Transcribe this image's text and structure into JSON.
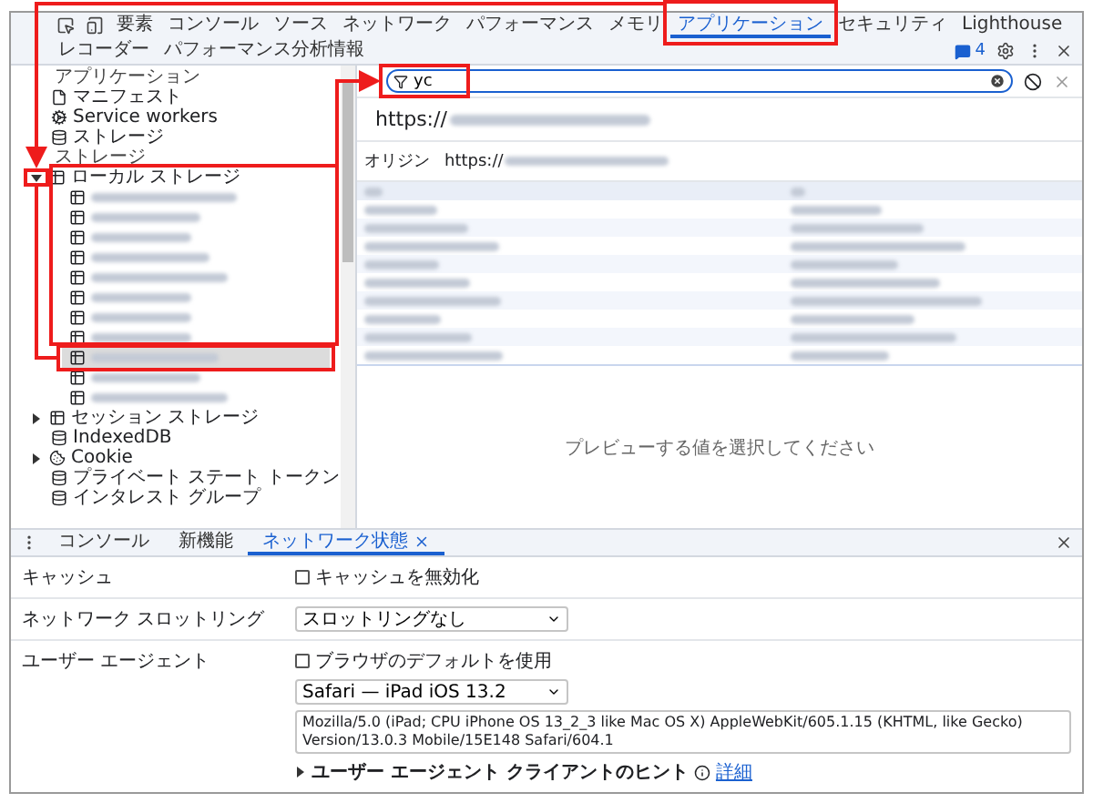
{
  "toolbar": {
    "tabs": [
      {
        "label": "要素",
        "selected": false,
        "annotated": false
      },
      {
        "label": "コンソール",
        "selected": false,
        "annotated": false
      },
      {
        "label": "ソース",
        "selected": false,
        "annotated": false
      },
      {
        "label": "ネットワーク",
        "selected": false,
        "annotated": false
      },
      {
        "label": "パフォーマンス",
        "selected": false,
        "annotated": false
      },
      {
        "label": "メモリ",
        "selected": false,
        "annotated": false
      },
      {
        "label": "アプリケーション",
        "selected": true,
        "annotated": true
      },
      {
        "label": "セキュリティ",
        "selected": false,
        "annotated": false
      },
      {
        "label": "Lighthouse",
        "selected": false,
        "annotated": false
      },
      {
        "label": "レコーダー",
        "selected": false,
        "annotated": false
      },
      {
        "label": "パフォーマンス分析情報",
        "selected": false,
        "annotated": false
      }
    ],
    "issues_count": "4"
  },
  "sidebar": {
    "sections": [
      {
        "title": "アプリケーション",
        "items": [
          {
            "label": "マニフェスト"
          },
          {
            "label": "Service workers"
          },
          {
            "label": "ストレージ"
          }
        ]
      },
      {
        "title": "ストレージ",
        "items": [
          {
            "label": "ローカル ストレージ",
            "expanded": true,
            "annotated": true,
            "children": [
              {
                "selected": false
              },
              {
                "selected": false
              },
              {
                "selected": false
              },
              {
                "selected": false
              },
              {
                "selected": false
              },
              {
                "selected": false
              },
              {
                "selected": false
              },
              {
                "selected": false
              },
              {
                "selected": true
              },
              {
                "selected": false
              },
              {
                "selected": false
              }
            ]
          },
          {
            "label": "セッション ストレージ",
            "expanded": false
          },
          {
            "label": "IndexedDB"
          },
          {
            "label": "Cookie",
            "expanded": false
          },
          {
            "label": "プライベート ステート トークン"
          },
          {
            "label": "インタレスト グループ"
          }
        ]
      }
    ]
  },
  "filter": {
    "value": "yc",
    "annotated": true
  },
  "detail": {
    "url_prefix": "https://",
    "origin_label": "オリジン",
    "origin_prefix": "https://",
    "rows": [
      {
        "selected": false
      },
      {
        "selected": false
      },
      {
        "selected": false
      },
      {
        "selected": false
      },
      {
        "selected": false
      },
      {
        "selected": false
      },
      {
        "selected": false
      },
      {
        "selected": false
      },
      {
        "selected": false
      }
    ],
    "preview_message": "プレビューする値を選択してください"
  },
  "drawer": {
    "tabs": [
      {
        "label": "コンソール",
        "selected": false,
        "closable": false
      },
      {
        "label": "新機能",
        "selected": false,
        "closable": false
      },
      {
        "label": "ネットワーク状態",
        "selected": true,
        "closable": true
      }
    ],
    "settings": [
      {
        "label": "キャッシュ",
        "controls": [
          {
            "kind": "checkbox",
            "label": "キャッシュを無効化",
            "checked": false
          }
        ]
      },
      {
        "label": "ネットワーク スロットリング",
        "controls": [
          {
            "kind": "select",
            "value": "スロットリングなし"
          }
        ]
      },
      {
        "label": "ユーザー エージェント",
        "controls": [
          {
            "kind": "checkbox",
            "label": "ブラウザのデフォルトを使用",
            "checked": false
          },
          {
            "kind": "select",
            "value": "Safari — iPad iOS 13.2"
          },
          {
            "kind": "text",
            "value": "Mozilla/5.0 (iPad; CPU iPhone OS 13_2_3 like Mac OS X) AppleWebKit/605.1.15 (KHTML, like Gecko) Version/13.0.3 Mobile/15E148 Safari/604.1"
          },
          {
            "kind": "disclosure",
            "label": "ユーザー エージェント クライアントのヒント",
            "link": "詳細",
            "expanded": false
          }
        ]
      }
    ]
  }
}
